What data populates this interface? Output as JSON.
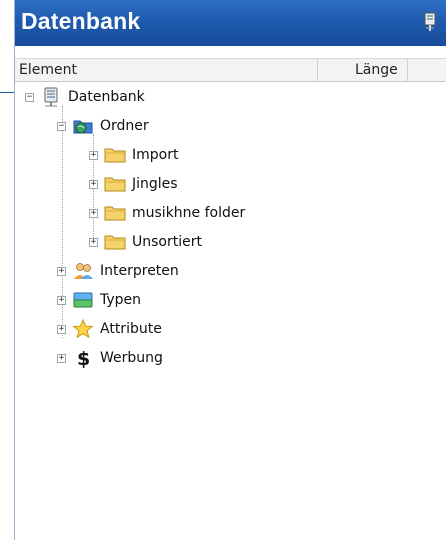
{
  "panel": {
    "title": "Datenbank",
    "header": {
      "col_element": "Element",
      "col_length": "Länge"
    }
  },
  "tree": {
    "root": {
      "label": "Datenbank",
      "icon": "database-icon"
    },
    "ordner": {
      "label": "Ordner",
      "icon": "folder-globe-icon"
    },
    "folders": [
      {
        "label": "Import",
        "icon": "folder-icon"
      },
      {
        "label": "Jingles",
        "icon": "folder-icon"
      },
      {
        "label": "musikhne folder",
        "icon": "folder-icon"
      },
      {
        "label": "Unsortiert",
        "icon": "folder-icon"
      }
    ],
    "categories": [
      {
        "label": "Interpreten",
        "icon": "people-icon"
      },
      {
        "label": "Typen",
        "icon": "types-icon"
      },
      {
        "label": "Attribute",
        "icon": "star-icon"
      },
      {
        "label": "Werbung",
        "icon": "dollar-icon"
      }
    ]
  },
  "colors": {
    "title_bar": "#1f5bb0",
    "accent": "#2f6fc3"
  }
}
